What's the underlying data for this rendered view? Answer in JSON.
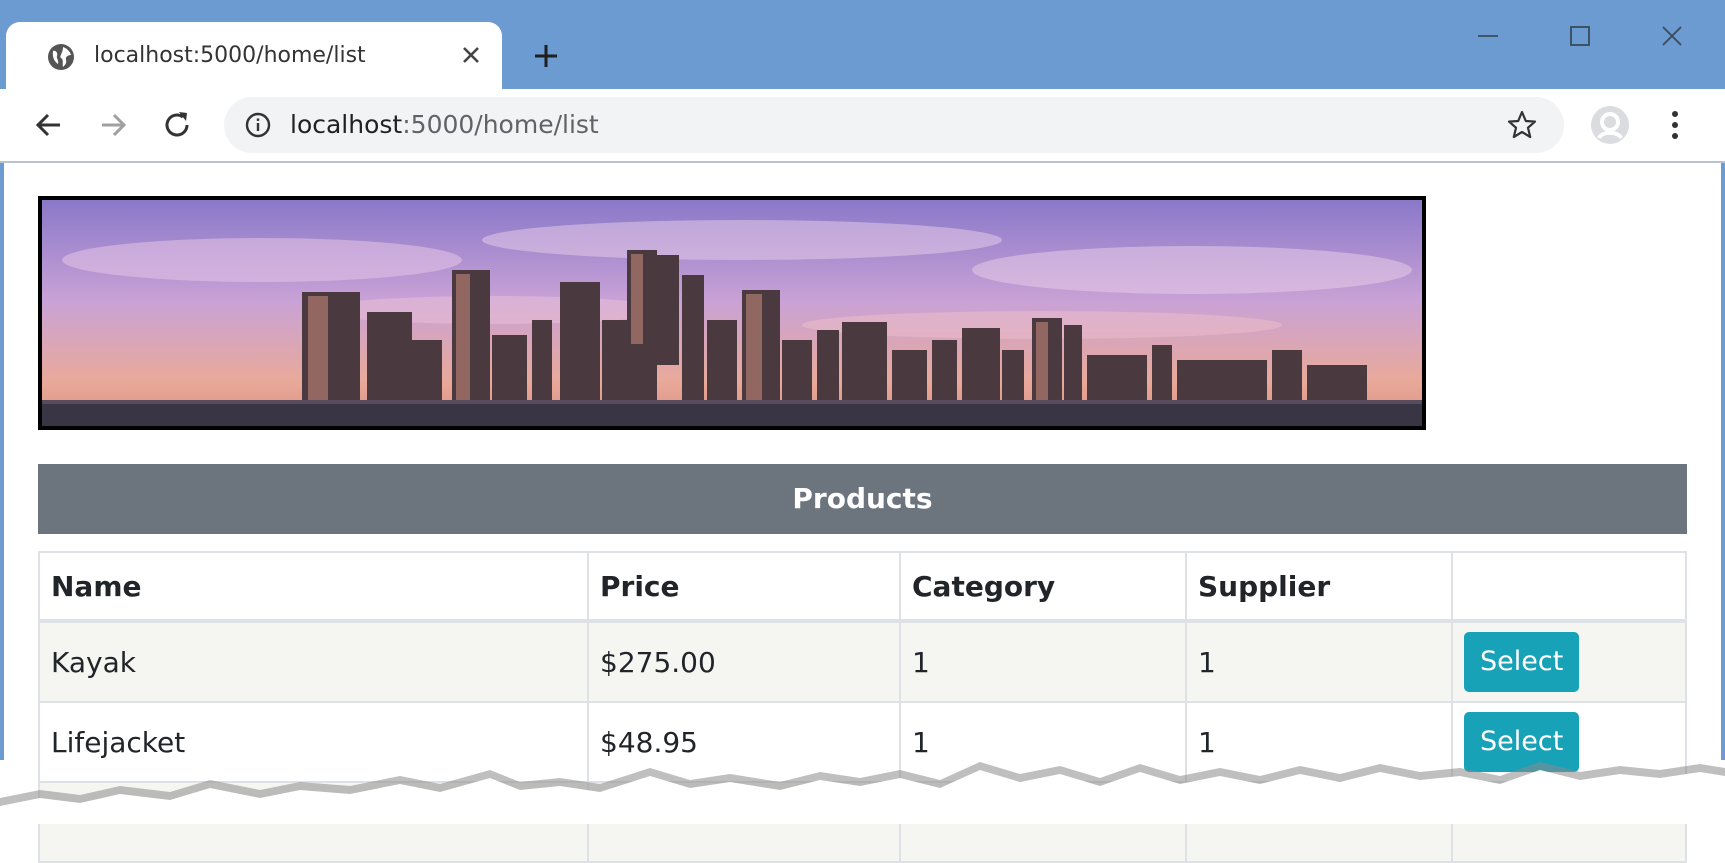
{
  "browser": {
    "tab_title": "localhost:5000/home/list",
    "url_host": "localhost",
    "url_rest": ":5000/home/list",
    "accent": "#6b9bd0"
  },
  "page": {
    "banner_icon": "city-skyline-image",
    "products_header": "Products",
    "table": {
      "columns": [
        "Name",
        "Price",
        "Category",
        "Supplier",
        ""
      ],
      "rows": [
        {
          "name": "Kayak",
          "price": "$275.00",
          "category": "1",
          "supplier": "1",
          "action": "Select"
        },
        {
          "name": "Lifejacket",
          "price": "$48.95",
          "category": "1",
          "supplier": "1",
          "action": "Select"
        }
      ]
    },
    "colors": {
      "header_bar": "#6c757d",
      "select_button": "#17a2b8",
      "stripe": "#f5f5f2"
    }
  }
}
